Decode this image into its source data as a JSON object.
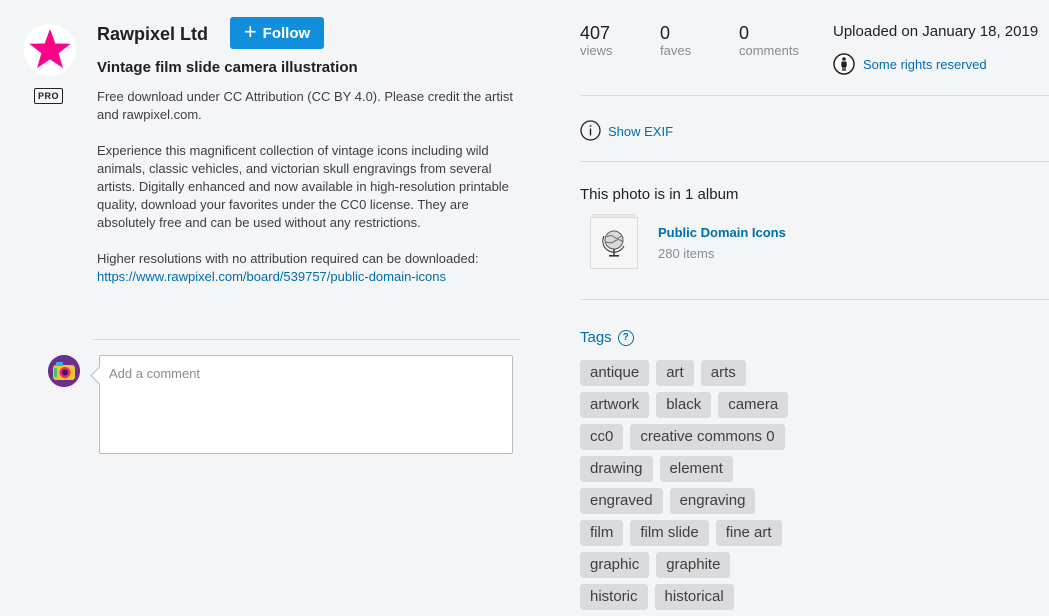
{
  "owner": {
    "name": "Rawpixel Ltd",
    "badge": "PRO",
    "follow_label": "Follow",
    "avatar_icon": "pink-star-icon",
    "avatar_color": "#ff0089"
  },
  "photo": {
    "title": "Vintage film slide camera illustration",
    "description": [
      "Free download under CC Attribution (CC BY 4.0). Please credit the artist and rawpixel.com.",
      "Experience this magnificent collection of vintage icons including wild animals, classic vehicles, and victorian skull engravings from several artists. Digitally enhanced and now available in high-resolution printable quality, download your favorites under the CC0 license. They are absolutely free and can be used without any restrictions.",
      "Higher resolutions with no attribution required can be downloaded:"
    ],
    "link": "https://www.rawpixel.com/board/539757/public-domain-icons"
  },
  "comment": {
    "placeholder": "Add a comment"
  },
  "stats": [
    {
      "value": "407",
      "label": "views"
    },
    {
      "value": "0",
      "label": "faves"
    },
    {
      "value": "0",
      "label": "comments"
    }
  ],
  "upload": {
    "date_text": "Uploaded on January 18, 2019",
    "license_label": "Some rights reserved",
    "license_icon": "cc-attribution-person-icon"
  },
  "exif": {
    "label": "Show EXIF",
    "icon": "info-icon"
  },
  "albums": {
    "heading": "This photo is in 1 album",
    "items": [
      {
        "name": "Public Domain Icons",
        "count": "280 items",
        "thumb_icon": "globe-thumbnail-icon"
      }
    ]
  },
  "tags": {
    "heading": "Tags",
    "rows": [
      [
        "antique",
        "art",
        "arts"
      ],
      [
        "artwork",
        "black",
        "camera"
      ],
      [
        "cc0",
        "creative commons 0"
      ],
      [
        "drawing",
        "element"
      ],
      [
        "engraved",
        "engraving"
      ],
      [
        "film",
        "film slide",
        "fine art"
      ],
      [
        "graphic",
        "graphite"
      ],
      [
        "historic",
        "historical"
      ]
    ]
  },
  "colors": {
    "accent_blue": "#128fdc",
    "link_blue": "#006dac",
    "tag_bg": "#dadbdc",
    "page_bg": "#f3f5f6"
  }
}
